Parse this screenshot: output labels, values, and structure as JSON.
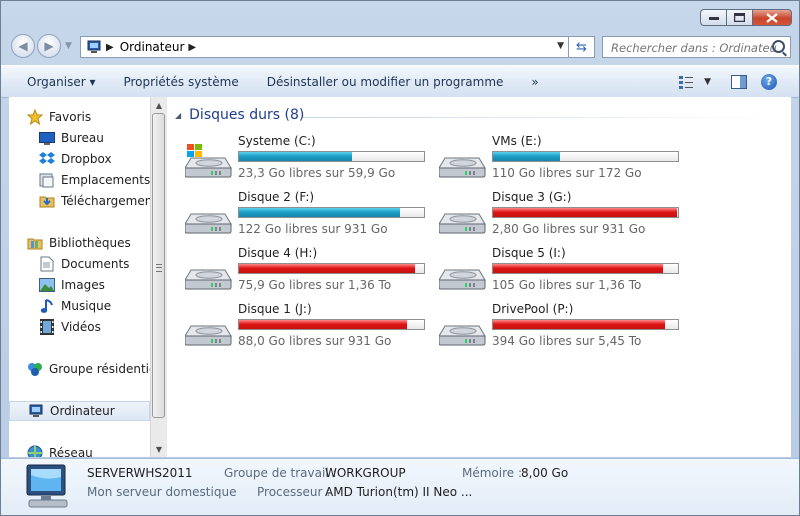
{
  "address": {
    "crumb": "Ordinateur"
  },
  "search": {
    "placeholder": "Rechercher dans : Ordinateur"
  },
  "toolbar": {
    "organize": "Organiser ▾",
    "system_props": "Propriétés système",
    "uninstall": "Désinstaller ou modifier un programme",
    "more": "»"
  },
  "sidebar": {
    "favorites": "Favoris",
    "desktop": "Bureau",
    "dropbox": "Dropbox",
    "recent": "Emplacements ré",
    "downloads": "Téléchargements",
    "libraries": "Bibliothèques",
    "documents": "Documents",
    "images": "Images",
    "music": "Musique",
    "videos": "Vidéos",
    "homegroup": "Groupe résidentiel",
    "computer": "Ordinateur",
    "network": "Réseau"
  },
  "content": {
    "group_title": "Disques durs (8)",
    "drives": [
      {
        "name": "Systeme (C:)",
        "free_text": "23,3 Go libres sur 59,9 Go",
        "used_fraction": 0.61,
        "status": "ok",
        "system": true
      },
      {
        "name": "VMs (E:)",
        "free_text": "110 Go libres sur 172 Go",
        "used_fraction": 0.36,
        "status": "ok",
        "system": false
      },
      {
        "name": "Disque 2 (F:)",
        "free_text": "122 Go libres sur 931 Go",
        "used_fraction": 0.87,
        "status": "ok",
        "system": false
      },
      {
        "name": "Disque 3 (G:)",
        "free_text": "2,80 Go libres sur 931 Go",
        "used_fraction": 0.997,
        "status": "low",
        "system": false
      },
      {
        "name": "Disque 4 (H:)",
        "free_text": "75,9 Go libres sur 1,36 To",
        "used_fraction": 0.95,
        "status": "low",
        "system": false
      },
      {
        "name": "Disque 5 (I:)",
        "free_text": "105 Go libres sur 1,36 To",
        "used_fraction": 0.92,
        "status": "low",
        "system": false
      },
      {
        "name": "Disque 1 (J:)",
        "free_text": "88,0 Go libres sur 931 Go",
        "used_fraction": 0.91,
        "status": "low",
        "system": false
      },
      {
        "name": "DrivePool (P:)",
        "free_text": "394 Go libres sur 5,45 To",
        "used_fraction": 0.93,
        "status": "low",
        "system": false
      }
    ]
  },
  "details": {
    "computer_name": "SERVERWHS2011",
    "description": "Mon serveur domestique",
    "workgroup_label": "Groupe de travail :",
    "workgroup_value": "WORKGROUP",
    "processor_label": "Processeur :",
    "processor_value": "AMD Turion(tm) II Neo ...",
    "memory_label": "Mémoire :",
    "memory_value": "8,00 Go"
  },
  "colors": {
    "bar_ok": "#1d9fc5",
    "bar_low": "#e01616",
    "group_title": "#1e3d8c"
  }
}
